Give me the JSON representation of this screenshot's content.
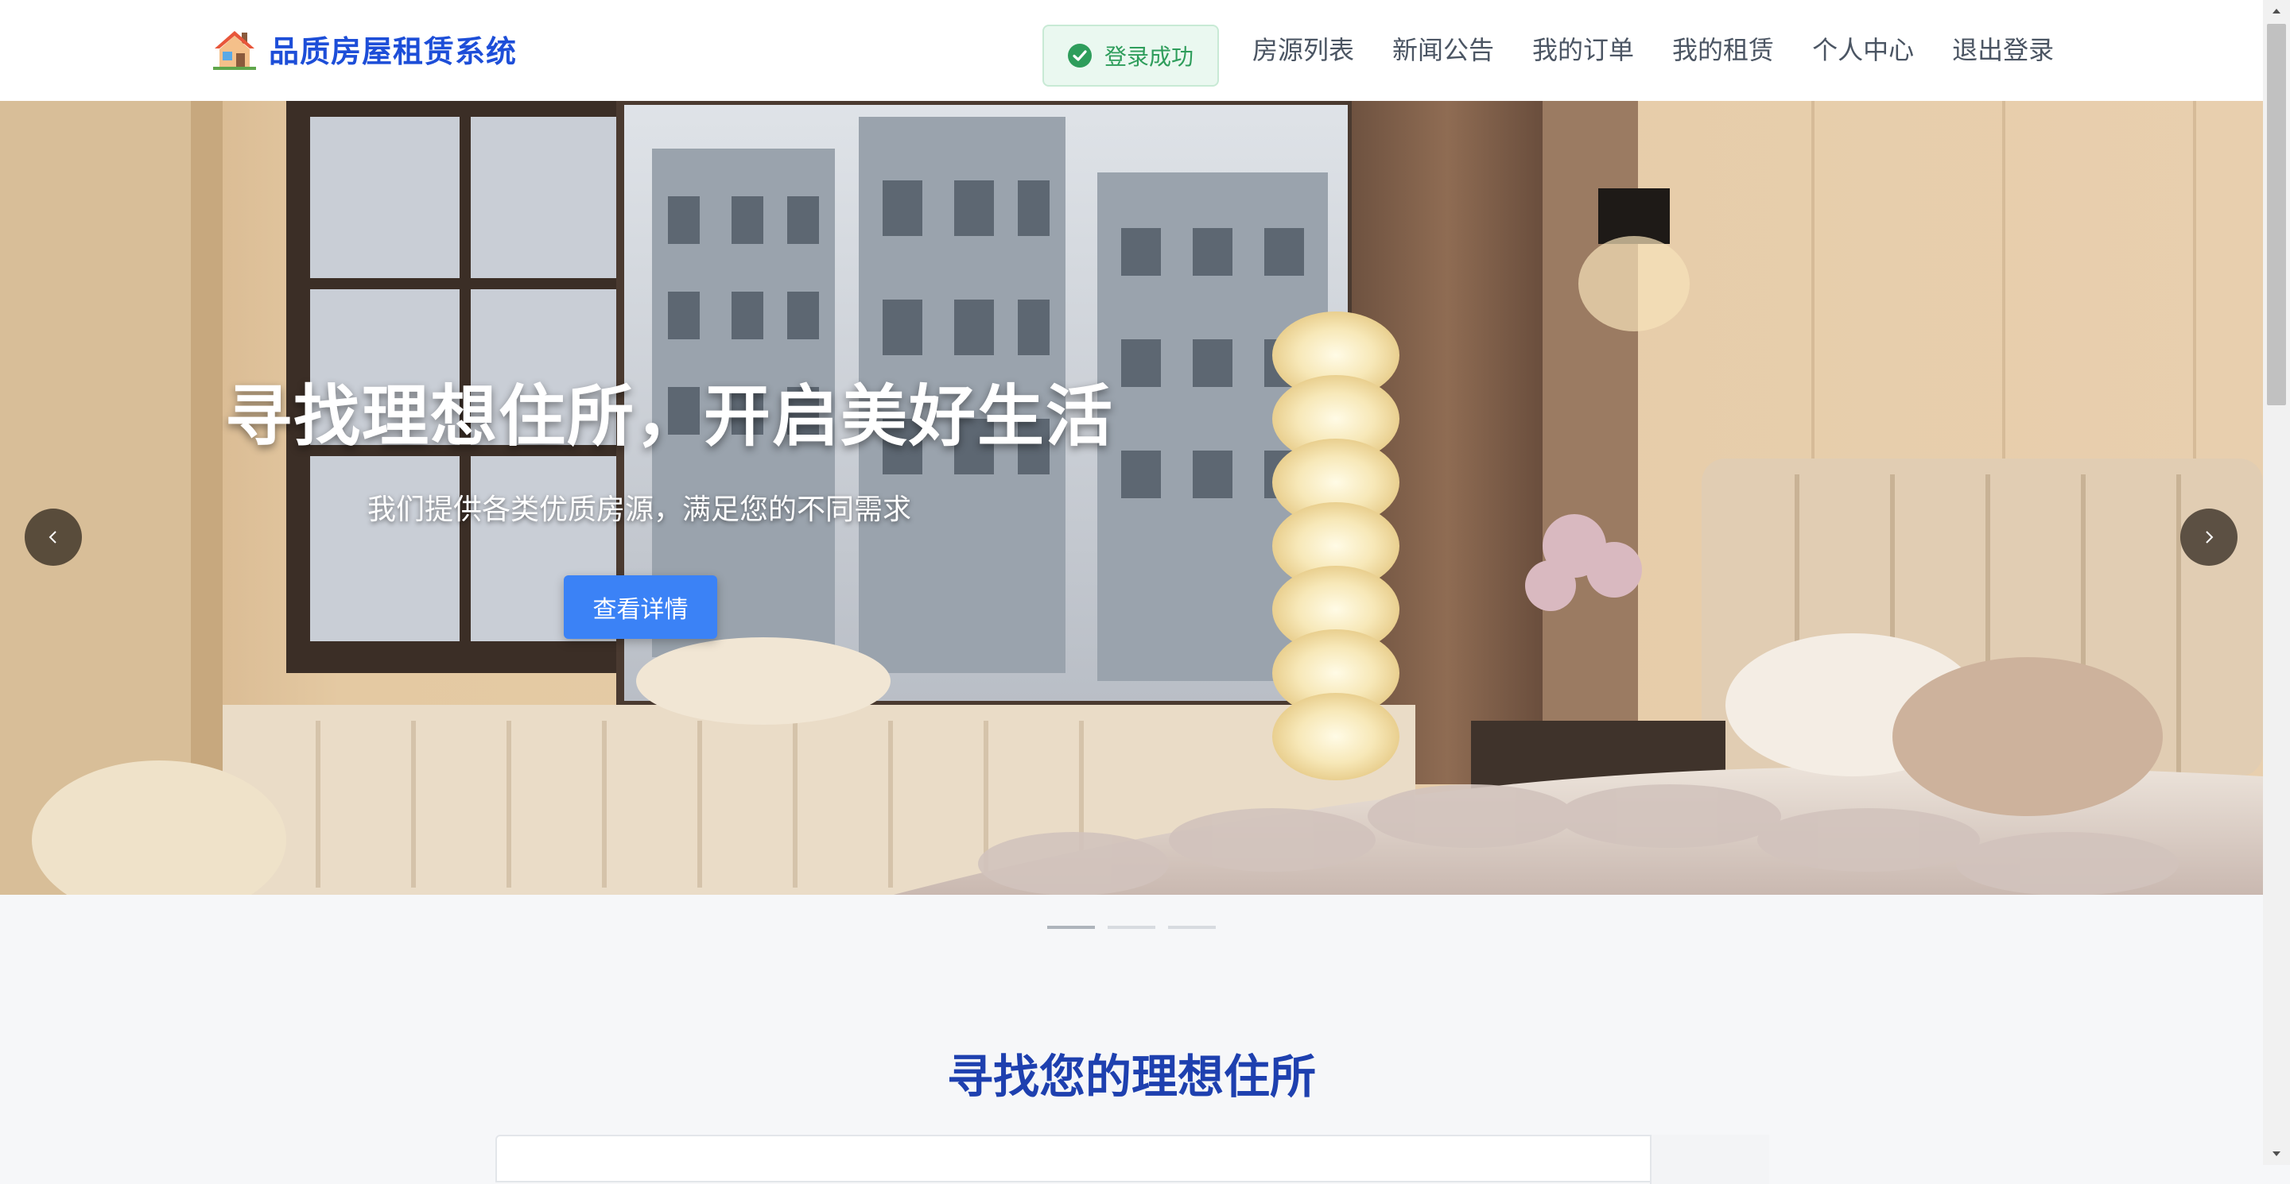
{
  "header": {
    "brand_title": "品质房屋租赁系统",
    "toast": "登录成功",
    "nav": [
      "房源列表",
      "新闻公告",
      "我的订单",
      "我的租赁",
      "个人中心",
      "退出登录"
    ]
  },
  "hero": {
    "title": "寻找理想住所，开启美好生活",
    "subtitle": "我们提供各类优质房源，满足您的不同需求",
    "button": "查看详情",
    "slides": 3,
    "active_slide": 1
  },
  "search": {
    "section_title": "寻找您的理想住所"
  },
  "colors": {
    "brand": "#1d4ed8",
    "success": "#2e9d5b",
    "primary_button": "#3b82f6",
    "section_title": "#1e40af"
  },
  "icons": [
    "house-icon",
    "check-circle-icon",
    "chevron-left-icon",
    "chevron-right-icon"
  ]
}
